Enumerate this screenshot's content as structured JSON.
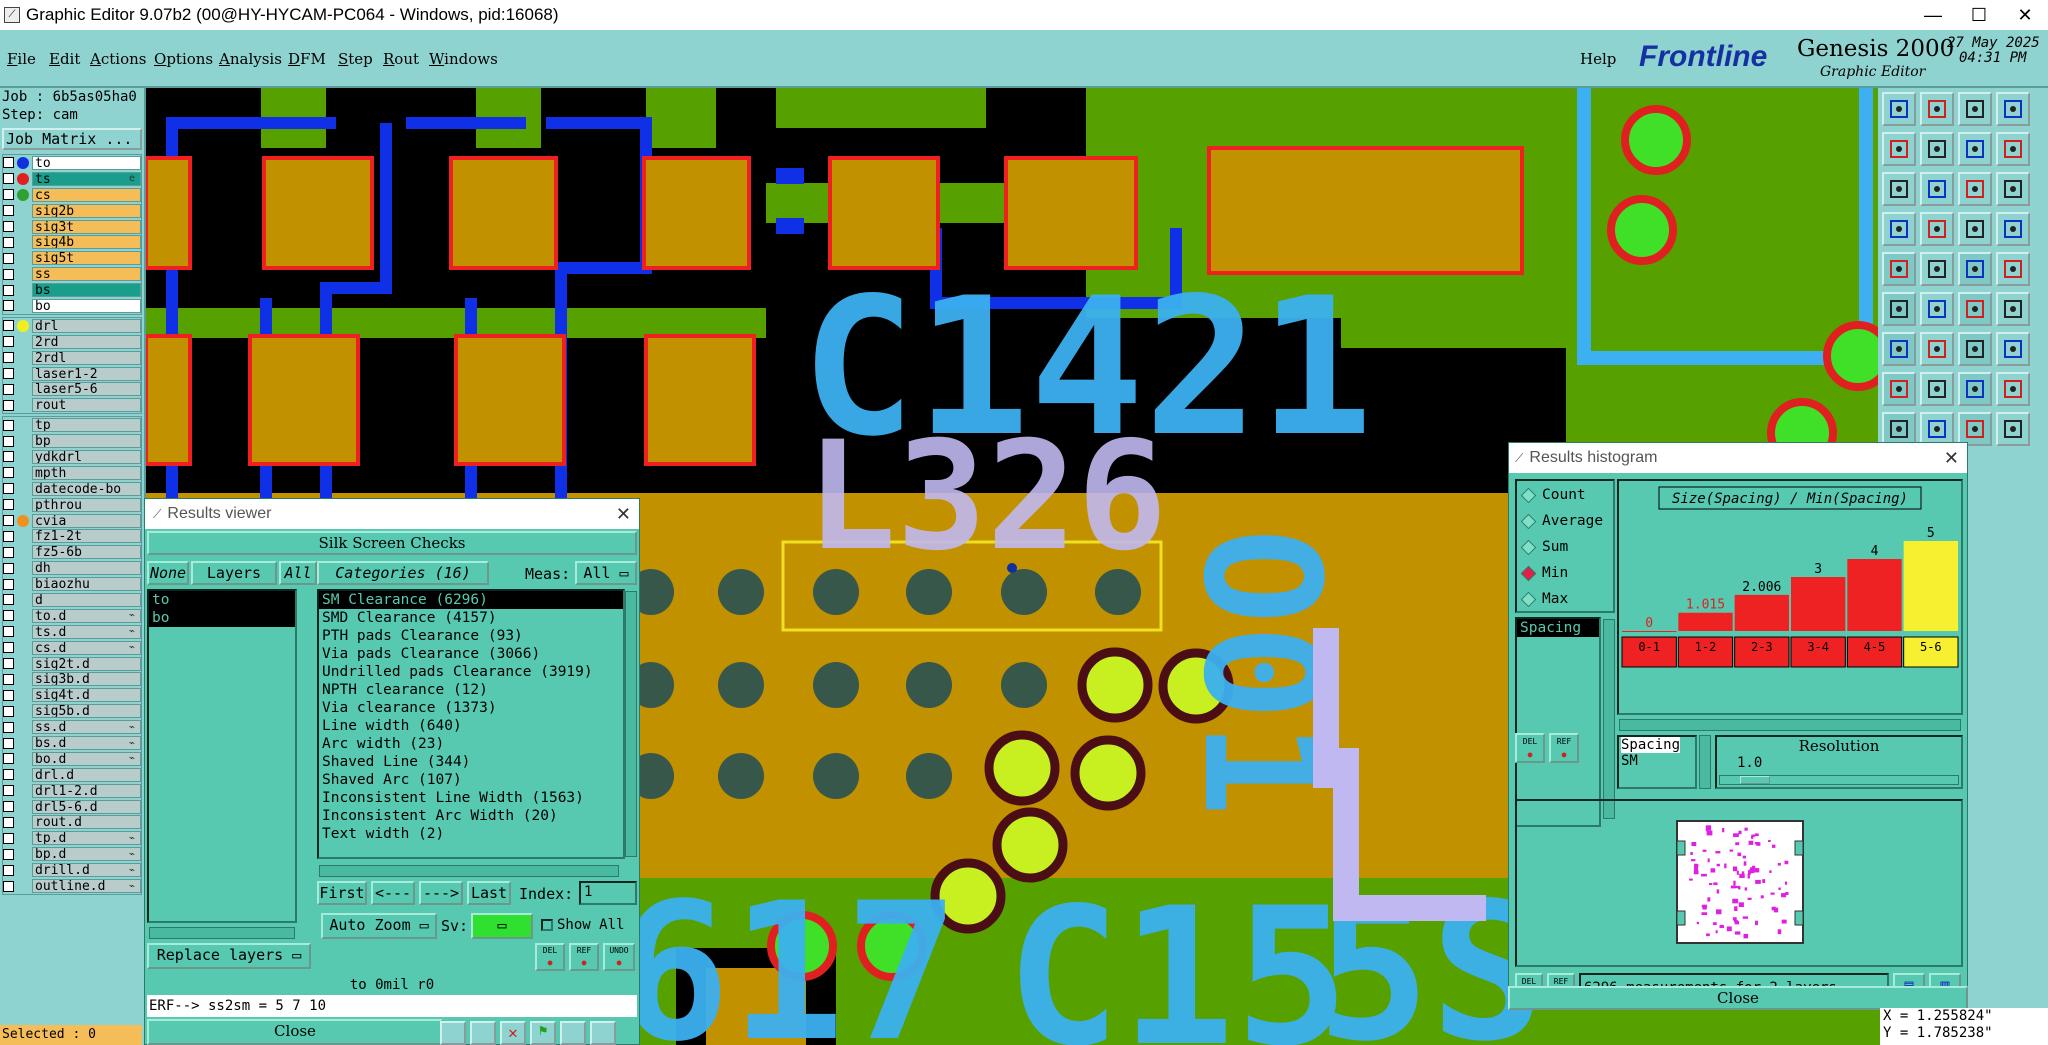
{
  "window": {
    "title": "Graphic Editor 9.07b2 (00@HY-HYCAM-PC064 - Windows, pid:16068)",
    "minimize": "—",
    "maximize": "☐",
    "close": "✕"
  },
  "menu": [
    {
      "label": "File",
      "u": "F",
      "rest": "ile"
    },
    {
      "label": "Edit",
      "u": "E",
      "rest": "dit"
    },
    {
      "label": "Actions",
      "u": "A",
      "rest": "ctions"
    },
    {
      "label": "Options",
      "u": "O",
      "rest": "ptions"
    },
    {
      "label": "Analysis",
      "u": "A",
      "rest": "nalysis"
    },
    {
      "label": "DFM",
      "u": "D",
      "rest": "FM"
    },
    {
      "label": "Step",
      "u": "S",
      "rest": "tep"
    },
    {
      "label": "Rout",
      "u": "R",
      "rest": "out"
    },
    {
      "label": "Windows",
      "u": "W",
      "rest": "indows"
    }
  ],
  "help": "Help",
  "logo": {
    "frontline": "Frontline",
    "genesis": "Genesis 2000",
    "sub": "Graphic Editor",
    "date": "27 May 2025",
    "time": "04:31 PM"
  },
  "job": {
    "job_line": "Job : 6b5as05ha0",
    "step_line": "Step: cam",
    "matrix_btn": "Job Matrix ..."
  },
  "layers_top": [
    {
      "name": "to",
      "bg": "#ffffff",
      "dot": "#1030e0"
    },
    {
      "name": "ts",
      "bg": "#1a9e8c",
      "dot": "#e02020",
      "mark": "e"
    },
    {
      "name": "cs",
      "bg": "#f4bd58",
      "dot": "#30a030"
    },
    {
      "name": "sig2b",
      "bg": "#f4bd58",
      "dot": ""
    },
    {
      "name": "sig3t",
      "bg": "#f4bd58",
      "dot": ""
    },
    {
      "name": "sig4b",
      "bg": "#f4bd58",
      "dot": ""
    },
    {
      "name": "sig5t",
      "bg": "#f4bd58",
      "dot": ""
    },
    {
      "name": "ss",
      "bg": "#f4bd58",
      "dot": ""
    },
    {
      "name": "bs",
      "bg": "#1a9e8c",
      "dot": ""
    },
    {
      "name": "bo",
      "bg": "#ffffff",
      "dot": ""
    }
  ],
  "layers_drill": [
    {
      "name": "drl",
      "bg": "#b8cccc",
      "dot": "#f0f020"
    },
    {
      "name": "2rd",
      "bg": "#b8cccc",
      "dot": ""
    },
    {
      "name": "2rdl",
      "bg": "#b8cccc",
      "dot": ""
    },
    {
      "name": "laser1-2",
      "bg": "#b8cccc",
      "dot": ""
    },
    {
      "name": "laser5-6",
      "bg": "#b8cccc",
      "dot": ""
    },
    {
      "name": "rout",
      "bg": "#b8cccc",
      "dot": ""
    }
  ],
  "layers_misc": [
    {
      "name": "tp",
      "dot": ""
    },
    {
      "name": "bp",
      "dot": ""
    },
    {
      "name": "ydkdrl",
      "dot": ""
    },
    {
      "name": "mpth",
      "dot": ""
    },
    {
      "name": "datecode-bo",
      "dot": ""
    },
    {
      "name": "pthrou",
      "dot": ""
    },
    {
      "name": "cvia",
      "dot": "#f09020"
    },
    {
      "name": "fz1-2t",
      "dot": ""
    },
    {
      "name": "fz5-6b",
      "dot": ""
    },
    {
      "name": "dh",
      "dot": ""
    },
    {
      "name": "biaozhu",
      "dot": ""
    },
    {
      "name": "d",
      "dot": ""
    },
    {
      "name": "to.d",
      "dot": "",
      "mark": "⌁"
    },
    {
      "name": "ts.d",
      "dot": "",
      "mark": "⌁"
    },
    {
      "name": "cs.d",
      "dot": "",
      "mark": "⌁"
    },
    {
      "name": "sig2t.d",
      "dot": ""
    },
    {
      "name": "sig3b.d",
      "dot": ""
    },
    {
      "name": "sig4t.d",
      "dot": ""
    },
    {
      "name": "sig5b.d",
      "dot": ""
    },
    {
      "name": "ss.d",
      "dot": "",
      "mark": "⌁"
    },
    {
      "name": "bs.d",
      "dot": "",
      "mark": "⌁"
    },
    {
      "name": "bo.d",
      "dot": "",
      "mark": "⌁"
    },
    {
      "name": "drl.d",
      "dot": ""
    },
    {
      "name": "drl1-2.d",
      "dot": ""
    },
    {
      "name": "drl5-6.d",
      "dot": ""
    },
    {
      "name": "rout.d",
      "dot": ""
    },
    {
      "name": "tp.d",
      "dot": "",
      "mark": "⌁"
    },
    {
      "name": "bp.d",
      "dot": "",
      "mark": "⌁"
    },
    {
      "name": "drill.d",
      "dot": "",
      "mark": "⌁"
    },
    {
      "name": "outline.d",
      "dot": "",
      "mark": "⌁"
    }
  ],
  "selected": "Selected : 0",
  "silk_labels": {
    "top": "C1421",
    "right": "O01",
    "mid": "L326",
    "bottom_left": "617",
    "bottom_mid": "C15",
    "bottom_right": "5S"
  },
  "results_viewer": {
    "title": "Results viewer",
    "header": "Silk Screen Checks",
    "none": "None",
    "layers": "Layers",
    "all": "All",
    "categories_btn": "Categories (16)",
    "meas_label": "Meas:",
    "meas_value": "All",
    "layer_items": [
      "to",
      "bo"
    ],
    "categories": [
      "SM Clearance (6296)",
      "SMD Clearance (4157)",
      "PTH pads Clearance (93)",
      "Via pads Clearance (3066)",
      "Undrilled pads Clearance (3919)",
      "NPTH clearance (12)",
      "Via clearance (1373)",
      "Line width (640)",
      "Arc width (23)",
      "Shaved Line (344)",
      "Shaved Arc (107)",
      "Inconsistent Line Width (1563)",
      "Inconsistent Arc Width (20)",
      "Text width (2)"
    ],
    "first": "First",
    "prev": "<---",
    "next": "--->",
    "last": "Last",
    "index_label": "Index:",
    "index_value": "1",
    "auto_zoom": "Auto Zoom",
    "sv_label": "Sv:",
    "show_all": "Show All",
    "replace_layers": "Replace layers",
    "del": "DEL",
    "ref": "REF",
    "und": "UNDO",
    "status1": "to 0mil  r0",
    "status2": "ERF--> ss2sm = 5 7 10",
    "close": "Close"
  },
  "histogram": {
    "title": "Results histogram",
    "modes": [
      "Count",
      "Average",
      "Sum",
      "Min",
      "Max"
    ],
    "selected_mode": "Min",
    "list_item": "Spacing",
    "chart_title": "Size(Spacing) / Min(Spacing)",
    "resolution_label": "Resolution",
    "resolution_value": "1.0",
    "sel_top": "Spacing",
    "sel_bottom": "SM",
    "del": "DEL",
    "ref": "REF",
    "count_text": "6296 measurements for 2 layers",
    "close": "Close"
  },
  "coords": {
    "x": "X = 1.255824\"",
    "y": "Y = 1.785238\""
  },
  "chart_data": {
    "type": "bar",
    "title": "Size(Spacing) / Min(Spacing)",
    "categories": [
      "0-1",
      "1-2",
      "2-3",
      "3-4",
      "4-5",
      "5-6"
    ],
    "values": [
      0,
      1.015,
      2.006,
      3,
      4,
      5
    ],
    "value_labels": [
      "0",
      "1.015",
      "2.006",
      "3",
      "4",
      "5"
    ],
    "colors": [
      "#ee2222",
      "#ee2222",
      "#ee2222",
      "#ee2222",
      "#ee2222",
      "#f6f030"
    ],
    "ylim": [
      0,
      5
    ],
    "grid": false,
    "legend": "none"
  }
}
